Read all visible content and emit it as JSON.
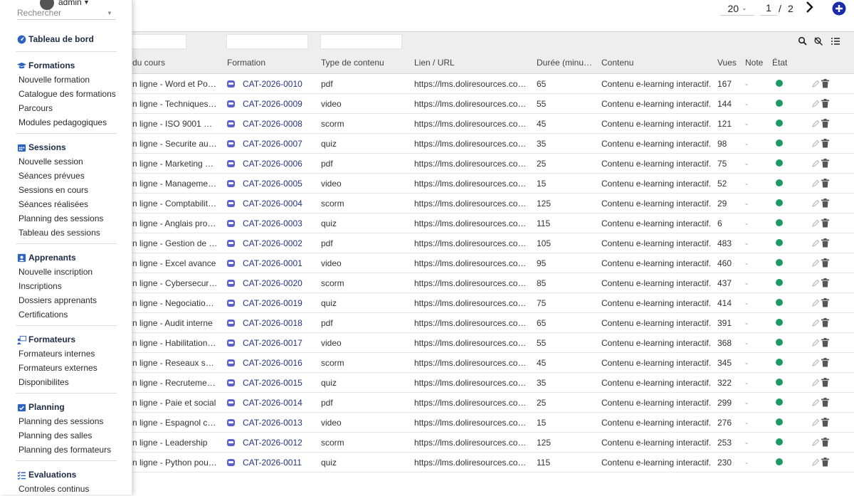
{
  "user": {
    "name": "admin"
  },
  "search": {
    "placeholder": "Rechercher"
  },
  "pagination": {
    "per_page": "20",
    "current_page": "1",
    "separator": "/",
    "total_pages": "2"
  },
  "colors": {
    "status_active": "#1d9a64",
    "link": "#26357e",
    "header_bg": "#eeeeee",
    "accent_icon": "#1b2aa8"
  },
  "sidebar": {
    "dashboard": {
      "label": "Tableau de bord",
      "icon": "gauge-icon"
    },
    "sections": [
      {
        "label": "Formations",
        "icon": "graduation-cap-icon",
        "items": [
          "Nouvelle formation",
          "Catalogue des formations",
          "Parcours",
          "Modules pedagogiques"
        ]
      },
      {
        "label": "Sessions",
        "icon": "calendar-icon",
        "items": [
          "Nouvelle session",
          "Séances prévues",
          "Sessions en cours",
          "Séances réalisées",
          "Planning des sessions",
          "Tableau des sessions"
        ]
      },
      {
        "label": "Apprenants",
        "icon": "user-card-icon",
        "items": [
          "Nouvelle inscription",
          "Inscriptions",
          "Dossiers apprenants",
          "Certifications"
        ]
      },
      {
        "label": "Formateurs",
        "icon": "teacher-board-icon",
        "items": [
          "Formateurs internes",
          "Formateurs externes",
          "Disponibilites"
        ]
      },
      {
        "label": "Planning",
        "icon": "calendar-check-icon",
        "items": [
          "Planning des sessions",
          "Planning des salles",
          "Planning des formateurs"
        ]
      },
      {
        "label": "Evaluations",
        "icon": "checklist-icon",
        "items": [
          "Controles continus"
        ]
      }
    ]
  },
  "table": {
    "columns": {
      "title": "du cours",
      "formation": "Formation",
      "type": "Type de contenu",
      "url": "Lien / URL",
      "duration": "Durée (minut…",
      "content": "Contenu",
      "views": "Vues",
      "note": "Note",
      "status": "État"
    },
    "rows": [
      {
        "title": "n ligne - Word et Pow…",
        "formation": "CAT-2026-0010",
        "type": "pdf",
        "url": "https://lms.doliresources.com/…",
        "duration": "65",
        "content": "Contenu e-learning interactif.",
        "views": "167",
        "note": "-"
      },
      {
        "title": "n ligne - Techniques d…",
        "formation": "CAT-2026-0009",
        "type": "video",
        "url": "https://lms.doliresources.com/…",
        "duration": "55",
        "content": "Contenu e-learning interactif.",
        "views": "144",
        "note": "-"
      },
      {
        "title": "n ligne - ISO 9001 Qu…",
        "formation": "CAT-2026-0008",
        "type": "scorm",
        "url": "https://lms.doliresources.com/…",
        "duration": "45",
        "content": "Contenu e-learning interactif.",
        "views": "121",
        "note": "-"
      },
      {
        "title": "n ligne - Securite au t…",
        "formation": "CAT-2026-0007",
        "type": "quiz",
        "url": "https://lms.doliresources.com/…",
        "duration": "35",
        "content": "Contenu e-learning interactif.",
        "views": "98",
        "note": "-"
      },
      {
        "title": "n ligne - Marketing di…",
        "formation": "CAT-2026-0006",
        "type": "pdf",
        "url": "https://lms.doliresources.com/…",
        "duration": "25",
        "content": "Contenu e-learning interactif.",
        "views": "75",
        "note": "-"
      },
      {
        "title": "n ligne - Management…",
        "formation": "CAT-2026-0005",
        "type": "video",
        "url": "https://lms.doliresources.com/…",
        "duration": "15",
        "content": "Contenu e-learning interactif.",
        "views": "52",
        "note": "-"
      },
      {
        "title": "n ligne - Comptabilite …",
        "formation": "CAT-2026-0004",
        "type": "scorm",
        "url": "https://lms.doliresources.com/…",
        "duration": "125",
        "content": "Contenu e-learning interactif.",
        "views": "29",
        "note": "-"
      },
      {
        "title": "n ligne - Anglais profe…",
        "formation": "CAT-2026-0003",
        "type": "quiz",
        "url": "https://lms.doliresources.com/…",
        "duration": "115",
        "content": "Contenu e-learning interactif.",
        "views": "6",
        "note": "-"
      },
      {
        "title": "n ligne - Gestion de p…",
        "formation": "CAT-2026-0002",
        "type": "pdf",
        "url": "https://lms.doliresources.com/…",
        "duration": "105",
        "content": "Contenu e-learning interactif.",
        "views": "483",
        "note": "-"
      },
      {
        "title": "n ligne - Excel avance",
        "formation": "CAT-2026-0001",
        "type": "video",
        "url": "https://lms.doliresources.com/…",
        "duration": "95",
        "content": "Contenu e-learning interactif.",
        "views": "460",
        "note": "-"
      },
      {
        "title": "n ligne - Cybersecurite",
        "formation": "CAT-2026-0020",
        "type": "scorm",
        "url": "https://lms.doliresources.com/…",
        "duration": "85",
        "content": "Contenu e-learning interactif.",
        "views": "437",
        "note": "-"
      },
      {
        "title": "n ligne - Negociation …",
        "formation": "CAT-2026-0019",
        "type": "quiz",
        "url": "https://lms.doliresources.com/…",
        "duration": "75",
        "content": "Contenu e-learning interactif.",
        "views": "414",
        "note": "-"
      },
      {
        "title": "n ligne - Audit interne",
        "formation": "CAT-2026-0018",
        "type": "pdf",
        "url": "https://lms.doliresources.com/…",
        "duration": "65",
        "content": "Contenu e-learning interactif.",
        "views": "391",
        "note": "-"
      },
      {
        "title": "n ligne - Habilitation e…",
        "formation": "CAT-2026-0017",
        "type": "video",
        "url": "https://lms.doliresources.com/…",
        "duration": "55",
        "content": "Contenu e-learning interactif.",
        "views": "368",
        "note": "-"
      },
      {
        "title": "n ligne - Reseaux soc…",
        "formation": "CAT-2026-0016",
        "type": "scorm",
        "url": "https://lms.doliresources.com/…",
        "duration": "45",
        "content": "Contenu e-learning interactif.",
        "views": "345",
        "note": "-"
      },
      {
        "title": "n ligne - Recrutement…",
        "formation": "CAT-2026-0015",
        "type": "quiz",
        "url": "https://lms.doliresources.com/…",
        "duration": "35",
        "content": "Contenu e-learning interactif.",
        "views": "322",
        "note": "-"
      },
      {
        "title": "n ligne - Paie et social",
        "formation": "CAT-2026-0014",
        "type": "pdf",
        "url": "https://lms.doliresources.com/…",
        "duration": "25",
        "content": "Contenu e-learning interactif.",
        "views": "299",
        "note": "-"
      },
      {
        "title": "n ligne - Espagnol co…",
        "formation": "CAT-2026-0013",
        "type": "video",
        "url": "https://lms.doliresources.com/…",
        "duration": "15",
        "content": "Contenu e-learning interactif.",
        "views": "276",
        "note": "-"
      },
      {
        "title": "n ligne - Leadership",
        "formation": "CAT-2026-0012",
        "type": "scorm",
        "url": "https://lms.doliresources.com/…",
        "duration": "125",
        "content": "Contenu e-learning interactif.",
        "views": "253",
        "note": "-"
      },
      {
        "title": "n ligne - Python pour …",
        "formation": "CAT-2026-0011",
        "type": "quiz",
        "url": "https://lms.doliresources.com/…",
        "duration": "115",
        "content": "Contenu e-learning interactif.",
        "views": "230",
        "note": "-"
      }
    ]
  }
}
